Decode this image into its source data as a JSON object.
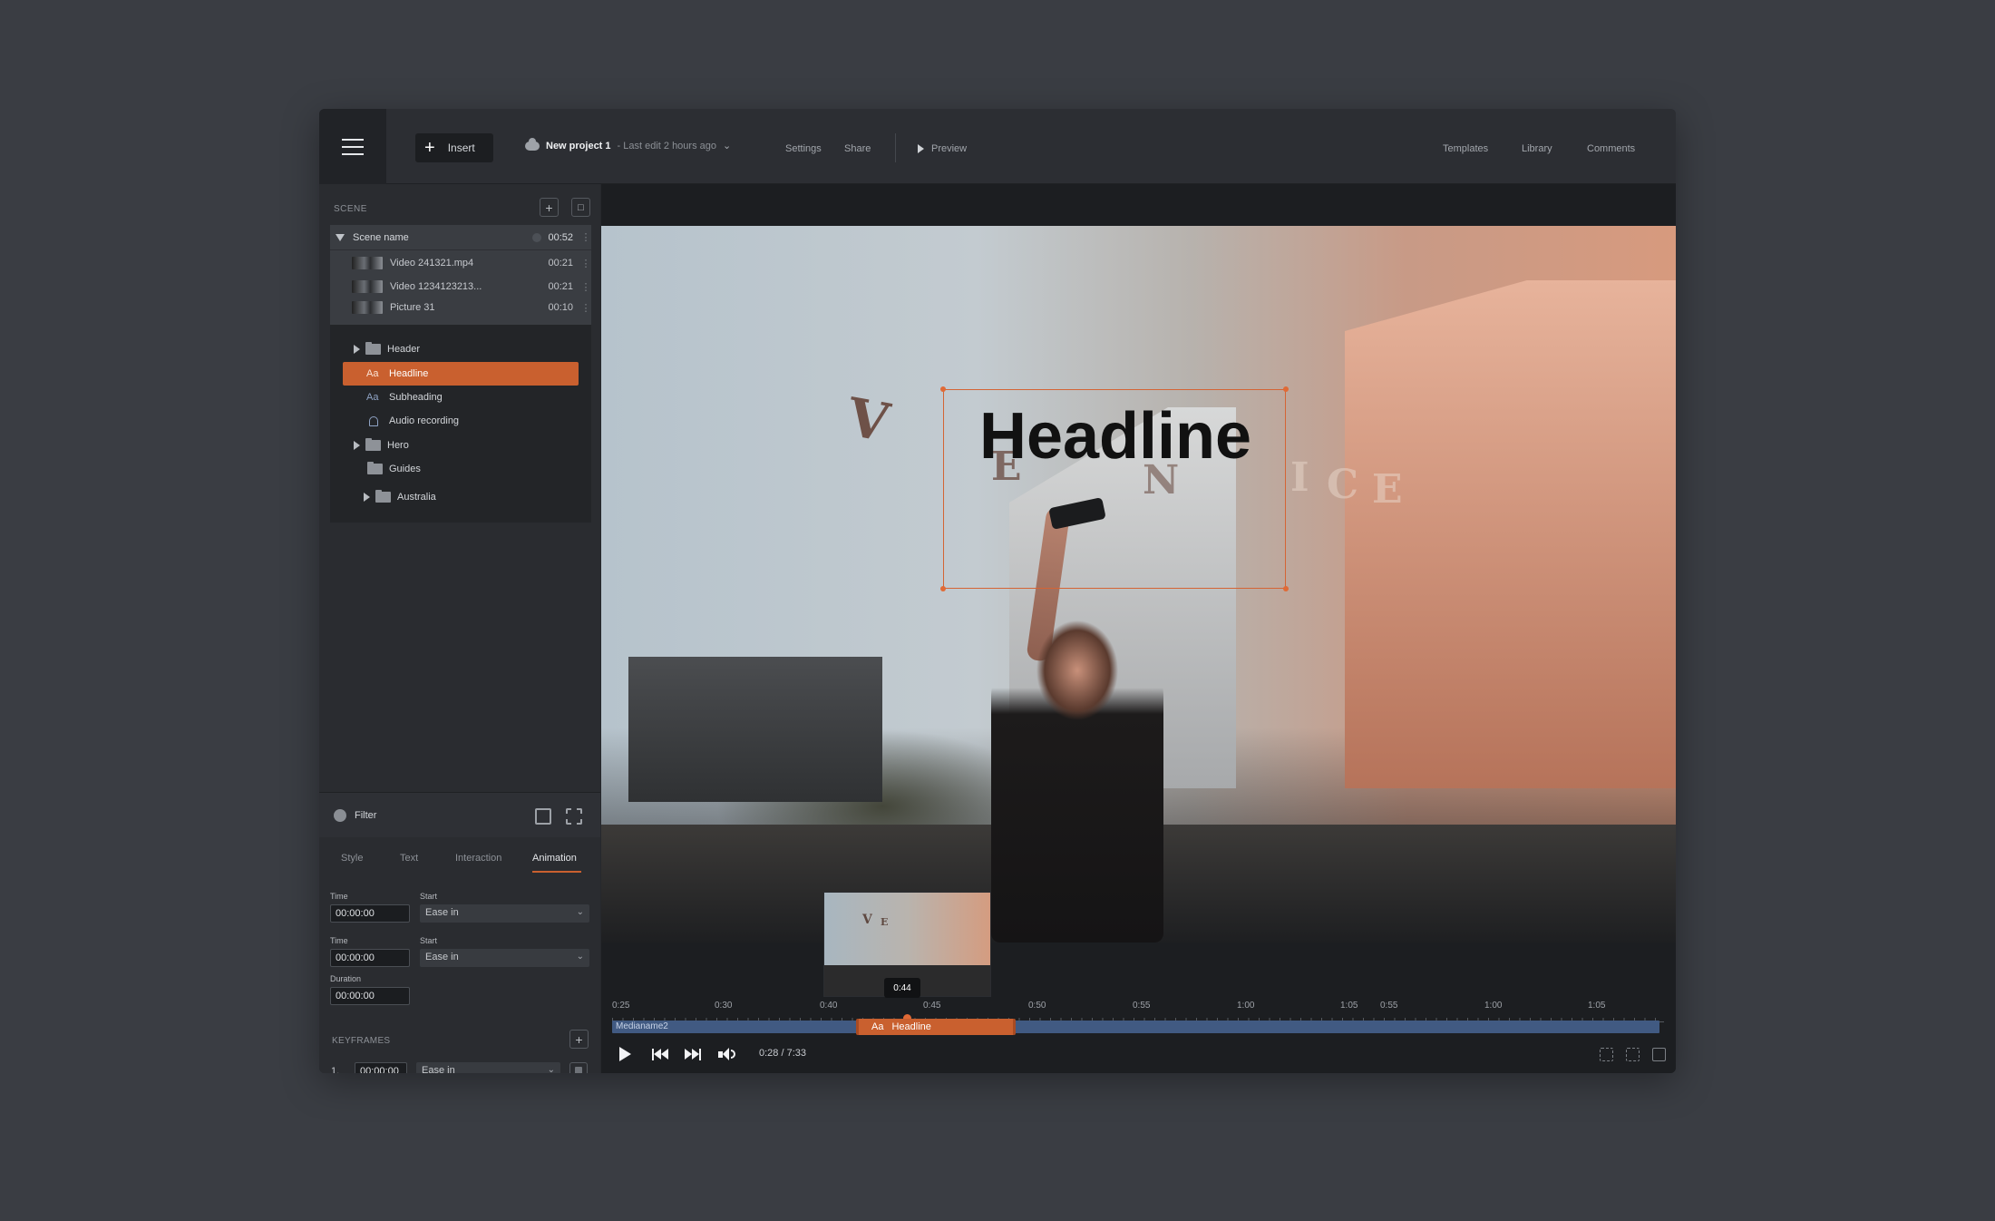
{
  "topbar": {
    "insert_label": "Insert",
    "project_name": "New project 1",
    "project_edit": "- Last edit 2 hours ago",
    "settings": "Settings",
    "share": "Share",
    "preview": "Preview",
    "templates": "Templates",
    "library": "Library",
    "comments": "Comments"
  },
  "scene": {
    "label": "SCENE",
    "name": "Scene name",
    "duration": "00:52",
    "media": [
      {
        "name": "Video 241321.mp4",
        "time": "00:21"
      },
      {
        "name": "Video 1234123213...",
        "time": "00:21"
      },
      {
        "name": "Picture 31",
        "time": "00:10"
      }
    ]
  },
  "layers": {
    "header": "Header",
    "headline": "Headline",
    "subheading": "Subheading",
    "audio": "Audio recording",
    "hero": "Hero",
    "guides": "Guides",
    "australia": "Australia",
    "aa": "Aa"
  },
  "filter": {
    "label": "Filter"
  },
  "tabs": {
    "style": "Style",
    "text": "Text",
    "interaction": "Interaction",
    "animation": "Animation"
  },
  "animation": {
    "time_label": "Time",
    "start_label": "Start",
    "duration_label": "Duration",
    "time1": "00:00:00",
    "ease1": "Ease in",
    "time2": "00:00:00",
    "ease2": "Ease in",
    "duration": "00:00:00"
  },
  "keyframes": {
    "label": "KEYFRAMES",
    "items": [
      {
        "index": "1.",
        "time": "00:00:00",
        "ease": "Ease in"
      }
    ]
  },
  "canvas": {
    "headline_text": "Headline",
    "venice_letters": [
      "V",
      "E",
      "N",
      "I",
      "C",
      "E"
    ]
  },
  "timeline": {
    "hover_time": "0:44",
    "ticks": [
      "0:25",
      "0:30",
      "0:40",
      "0:45",
      "0:50",
      "0:55",
      "1:00",
      "1:05",
      "0:55",
      "1:00",
      "1:05"
    ],
    "track_name": "Medianame2",
    "clip_name": "Headline",
    "time_readout": "0:28 / 7:33"
  },
  "colors": {
    "accent": "#c9602f",
    "track": "#415a82",
    "background": "#3a3d43"
  }
}
